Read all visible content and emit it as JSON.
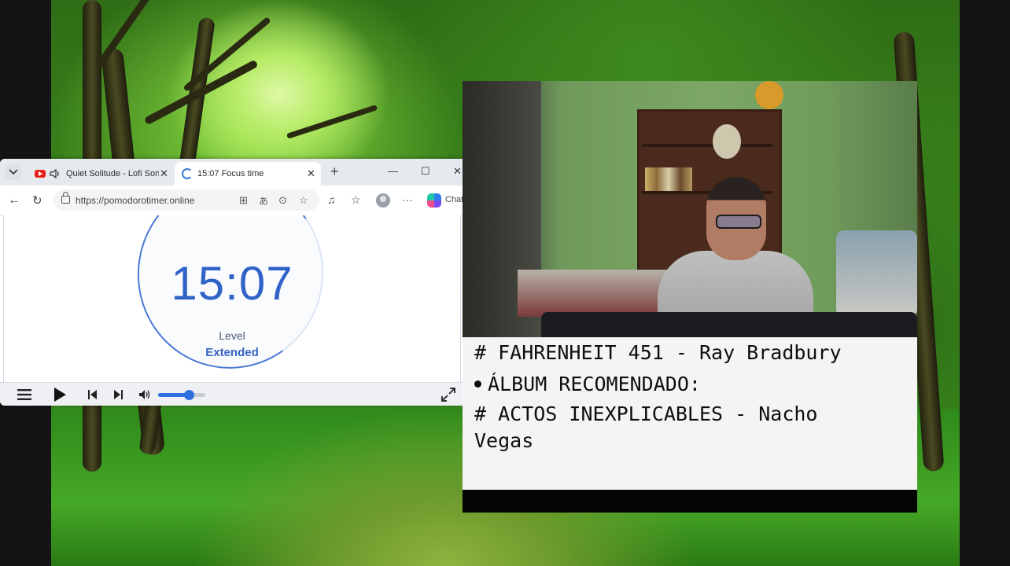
{
  "browser": {
    "tabs": [
      {
        "label": "Quiet Solitude - Lofi Son",
        "icon": "youtube-icon",
        "audio_icon": "speaker-icon"
      },
      {
        "label": "15:07 Focus time",
        "icon": "loading-icon"
      }
    ],
    "close_glyph": "✕",
    "new_tab_glyph": "+",
    "window_controls": {
      "minimize": "—",
      "maximize": "☐",
      "close": "✕"
    },
    "url": "https://pomodorotimer.online",
    "chat_label": "Chat"
  },
  "timer": {
    "time": "15:07",
    "level_label": "Level",
    "level_value": "Extended",
    "accent_color": "#2f63c8"
  },
  "player": {
    "volume_fraction": 0.65
  },
  "overlay_text": {
    "line1": "# FAHRENHEIT 451 - Ray Bradbury",
    "line2": "ÁLBUM RECOMENDADO:",
    "line3": "# ACTOS INEXPLICABLES - Nacho Vegas"
  }
}
